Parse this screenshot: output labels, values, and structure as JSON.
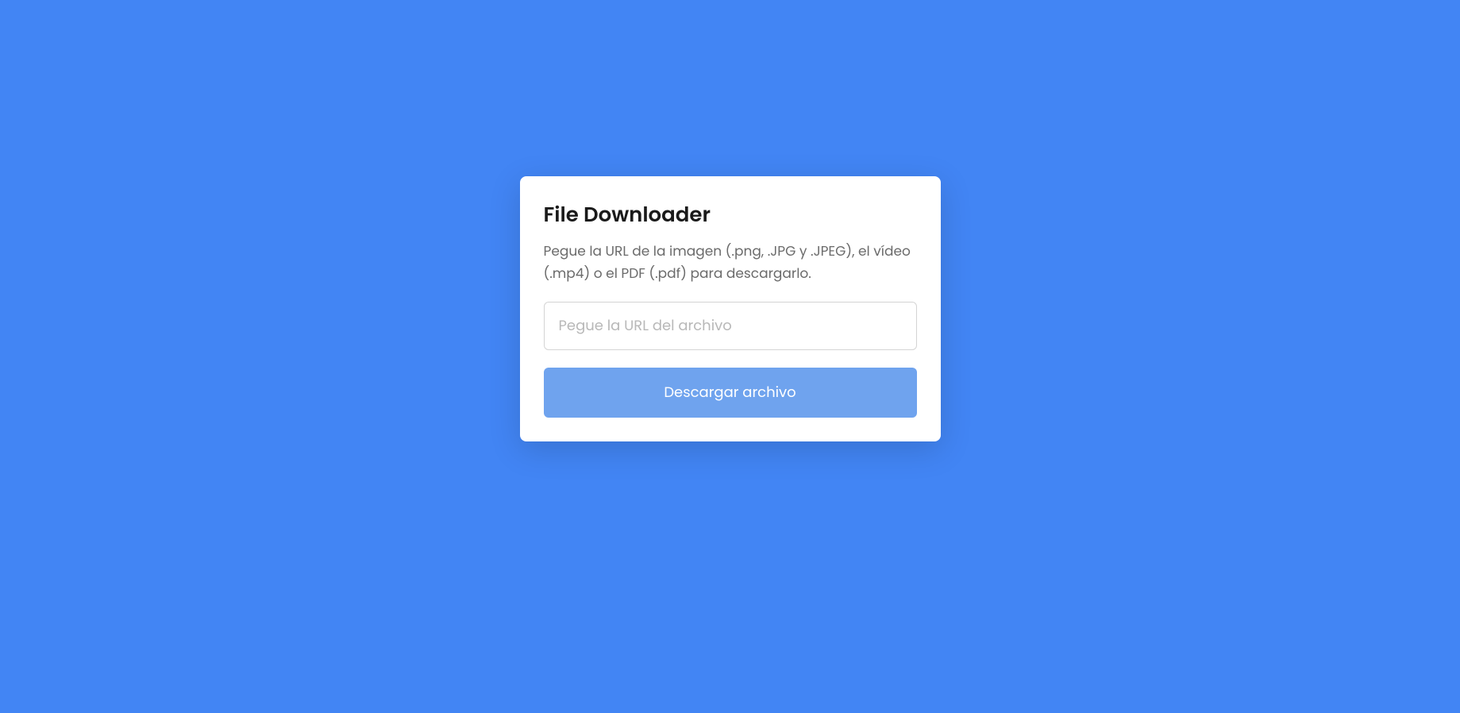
{
  "card": {
    "title": "File Downloader",
    "description": "Pegue la URL de la imagen (.png, .JPG y .JPEG), el vídeo (.mp4) o el PDF (.pdf) para descargarlo.",
    "input": {
      "placeholder": "Pegue la URL del archivo",
      "value": ""
    },
    "button": {
      "label": "Descargar archivo"
    }
  }
}
